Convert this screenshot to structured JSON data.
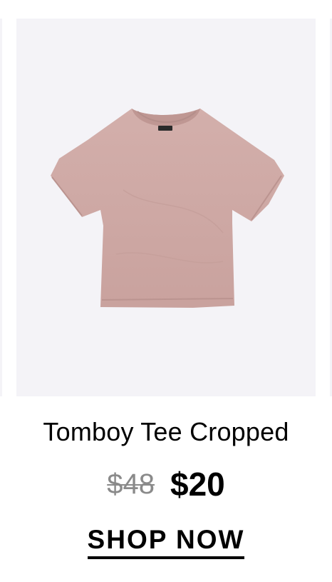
{
  "product": {
    "title": "Tomboy Tee Cropped",
    "original_price": "$48",
    "sale_price": "$20",
    "cta_label": "SHOP NOW",
    "image": {
      "icon": "t-shirt-image",
      "garment_color": "#cda8a4",
      "background_color": "#f4f3f7"
    }
  }
}
